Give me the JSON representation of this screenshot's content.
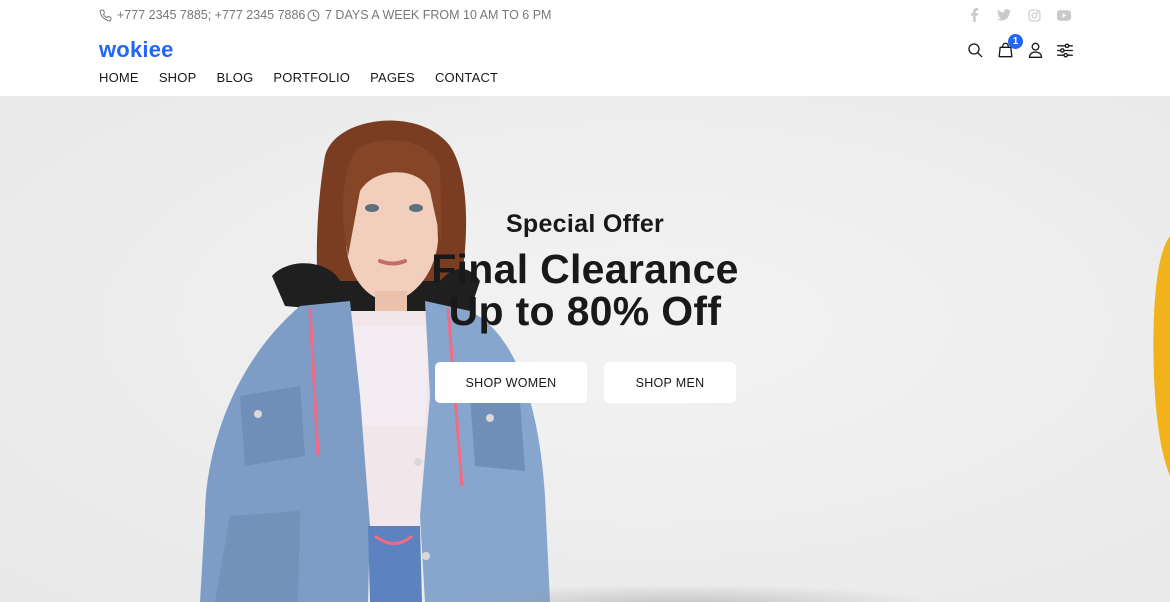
{
  "colors": {
    "accent": "#2267f3",
    "text": "#191919",
    "muted": "#777777",
    "social": "#c9c9c9",
    "hero_bg": "#ededed",
    "button_bg": "#ffffff"
  },
  "topbar": {
    "phone_icon": "phone-icon",
    "phone_text": "+777 2345 7885; +777 2345 7886",
    "hours_icon": "clock-icon",
    "hours_text": "7 DAYS A WEEK FROM 10 AM TO 6 PM",
    "socials": [
      "facebook-icon",
      "twitter-icon",
      "instagram-icon",
      "youtube-icon"
    ]
  },
  "header": {
    "logo": "wokiee",
    "nav": [
      "HOME",
      "SHOP",
      "BLOG",
      "PORTFOLIO",
      "PAGES",
      "CONTACT"
    ],
    "icons": [
      "search-icon",
      "cart-icon",
      "account-icon",
      "settings-icon"
    ],
    "cart_count": "1"
  },
  "hero": {
    "subtitle": "Special Offer",
    "title_line1": "Final Clearance",
    "title_line2": "Up to 80% Off",
    "buttons": [
      "SHOP WOMEN",
      "SHOP MEN"
    ]
  }
}
